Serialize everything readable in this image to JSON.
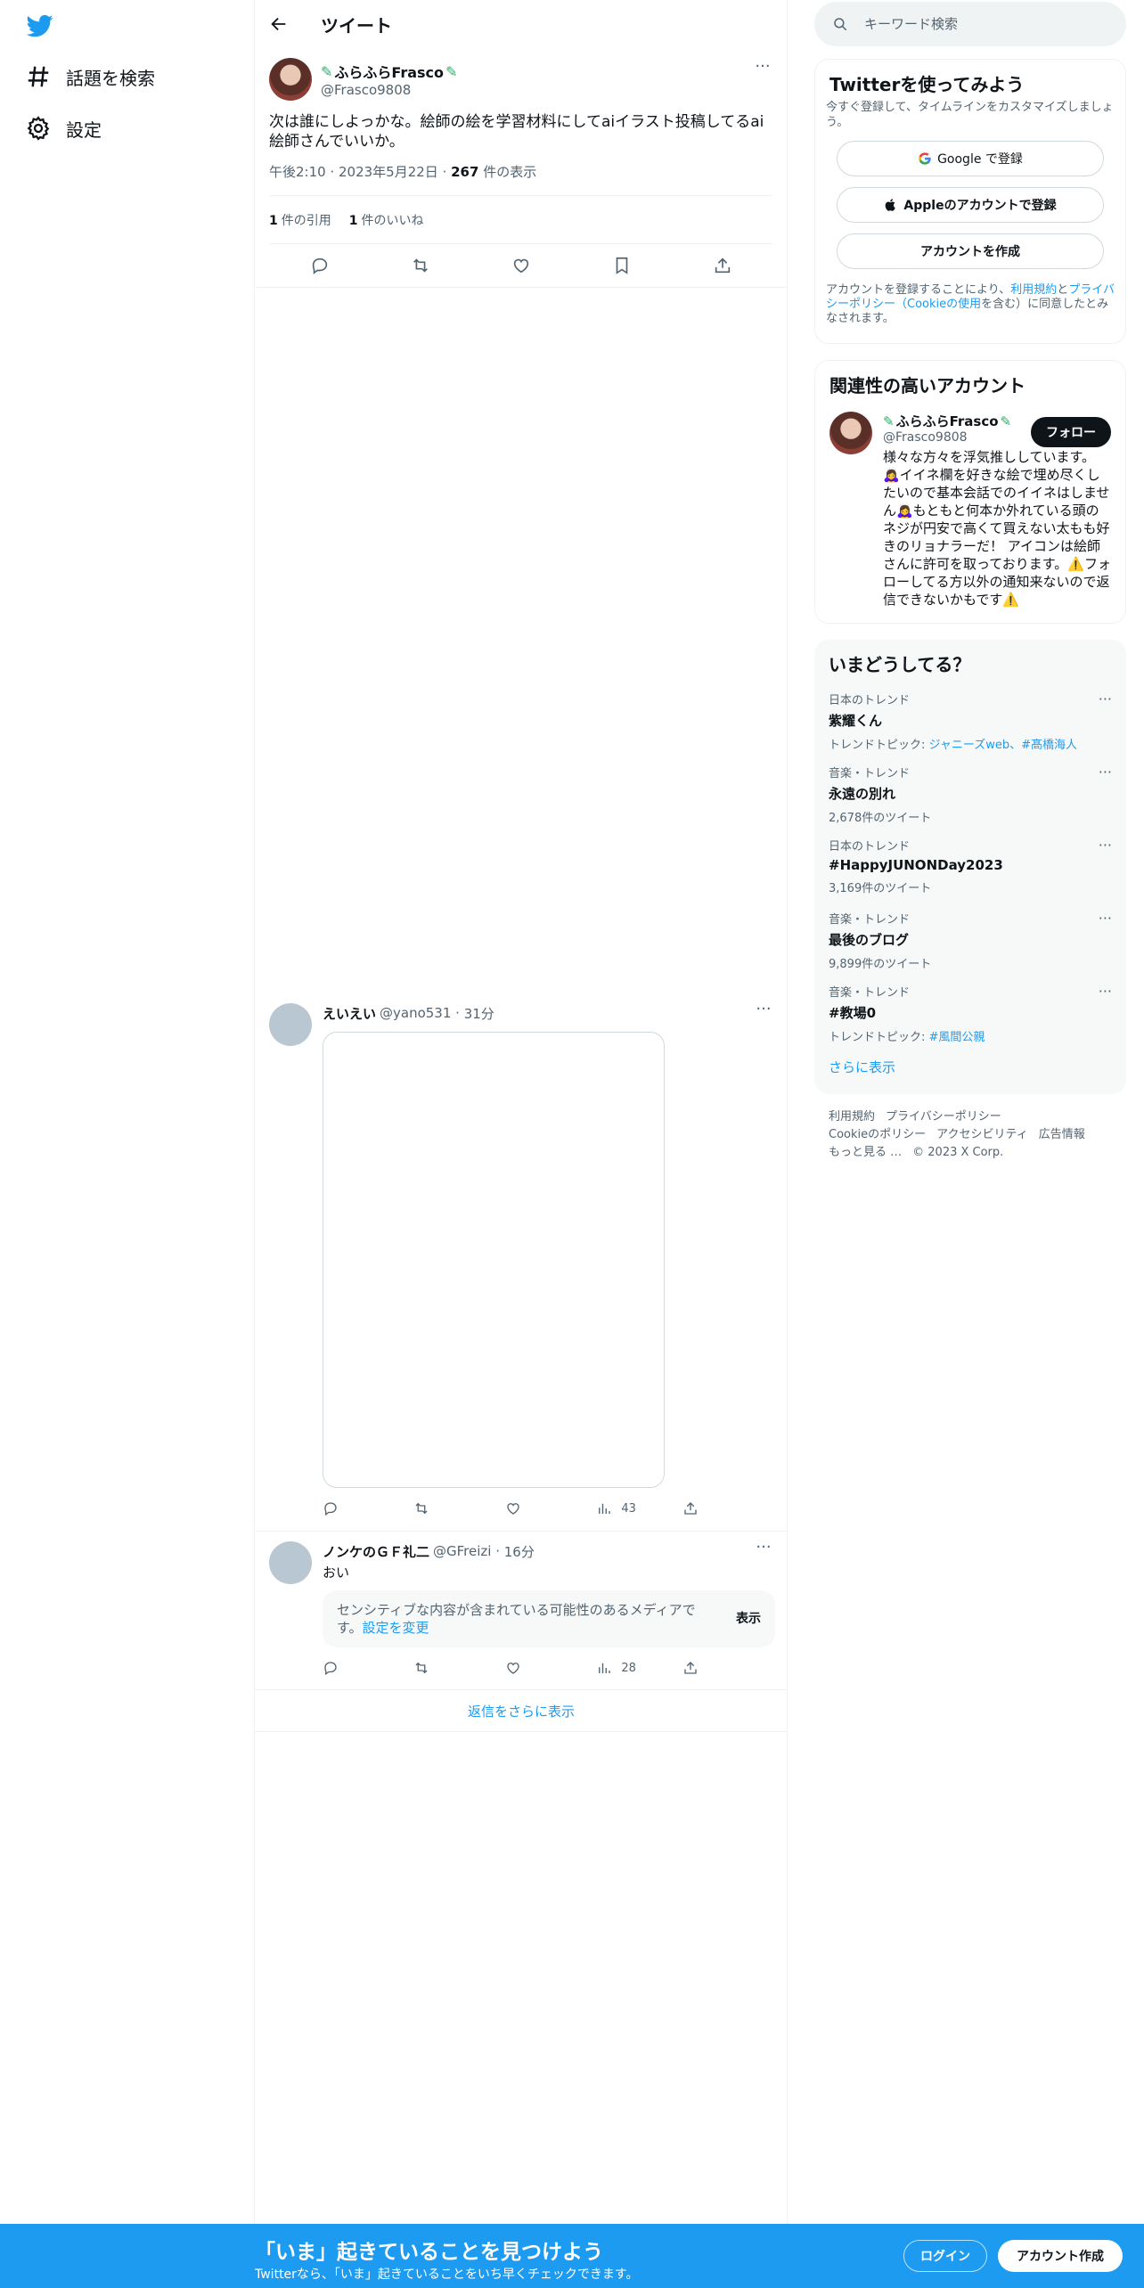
{
  "colors": {
    "accent": "#1d9bf0",
    "text": "#0f1419",
    "muted": "#536471",
    "border": "#eff3f4"
  },
  "nav": {
    "logo_icon": "twitter-bird-icon",
    "items": [
      {
        "label": "話題を検索",
        "icon": "hashtag-icon"
      },
      {
        "label": "設定",
        "icon": "gear-icon"
      }
    ]
  },
  "header": {
    "title": "ツイート",
    "back_icon": "arrow-left-icon"
  },
  "tweet": {
    "display_name": "ふらふらFrasco",
    "handle": "@Frasco9808",
    "text": "次は誰にしよっかな。絵師の絵を学習材料にしてaiイラスト投稿してるai絵師さんでいいか。",
    "time": "午後2:10",
    "date": "2023年5月22日",
    "views_count": "267",
    "views_label": " 件の表示",
    "quotes_count": "1",
    "quotes_label": "件の引用",
    "likes_count": "1",
    "likes_label": "件のいいね"
  },
  "replies": [
    {
      "display_name": "えいえい",
      "handle": "@yano531",
      "time": "31分",
      "views": "43"
    },
    {
      "display_name": "ノンケのＧＦ礼二",
      "handle": "@GFreizi",
      "time": "16分",
      "text": "おい",
      "sensitive_text": "センシティブな内容が含まれている可能性のあるメディアです。",
      "sensitive_link": "設定を変更",
      "sensitive_button": "表示",
      "views": "28"
    }
  ],
  "show_more_replies": "返信をさらに表示",
  "search": {
    "placeholder": "キーワード検索"
  },
  "signup": {
    "title": "Twitterを使ってみよう",
    "subtitle": "今すぐ登録して、タイムラインをカスタマイズしましょう。",
    "google_label": "Google で登録",
    "apple_label": "Appleのアカウントで登録",
    "create_label": "アカウントを作成",
    "terms_pre": "アカウントを登録することにより、",
    "terms_link1": "利用規約",
    "terms_mid": "と",
    "terms_link2": "プライバシーポリシー（Cookieの使用",
    "terms_post": "を含む）に同意したとみなされます。"
  },
  "related": {
    "title": "関連性の高いアカウント",
    "display_name": "ふらふらFrasco",
    "handle": "@Frasco9808",
    "follow_label": "フォロー",
    "bio": "様々な方々を浮気推ししています。🙇‍♀️イイネ欄を好きな絵で埋め尽くしたいので基本会話でのイイネはしません🙇‍♀️もともと何本か外れている頭のネジが円安で高くて買えない太もも好きのリョナラーだ！ アイコンは絵師さんに許可を取っております。⚠️フォローしてる方以外の通知来ないので返信できないかもです⚠️"
  },
  "trends": {
    "title": "いまどうしてる？",
    "items": [
      {
        "context": "日本のトレンド",
        "title": "紫耀くん",
        "meta_prefix": "トレンドトピック: ",
        "meta_link": "ジャニーズweb、#髙橋海人"
      },
      {
        "context": "音楽・トレンド",
        "title": "永遠の別れ",
        "meta_prefix": "2,678件のツイート",
        "meta_link": ""
      },
      {
        "context": "日本のトレンド",
        "title": "#HappyJUNONDay2023",
        "meta_prefix": "3,169件のツイート",
        "meta_link": ""
      },
      {
        "context": "音楽・トレンド",
        "title": "最後のブログ",
        "meta_prefix": "9,899件のツイート",
        "meta_link": ""
      },
      {
        "context": "音楽・トレンド",
        "title": "#教場0",
        "meta_prefix": "トレンドトピック: ",
        "meta_link": "#風間公親"
      }
    ],
    "show_more": "さらに表示"
  },
  "footer": {
    "links": [
      "利用規約",
      "プライバシーポリシー",
      "Cookieのポリシー",
      "アクセシビリティ",
      "広告情報",
      "もっと見る …"
    ],
    "copyright": "© 2023 X Corp."
  },
  "bottom_bar": {
    "title": "「いま」起きていることを見つけよう",
    "subtitle": "Twitterなら、「いま」起きていることをいち早くチェックできます。",
    "login_label": "ログイン",
    "create_label": "アカウント作成"
  }
}
